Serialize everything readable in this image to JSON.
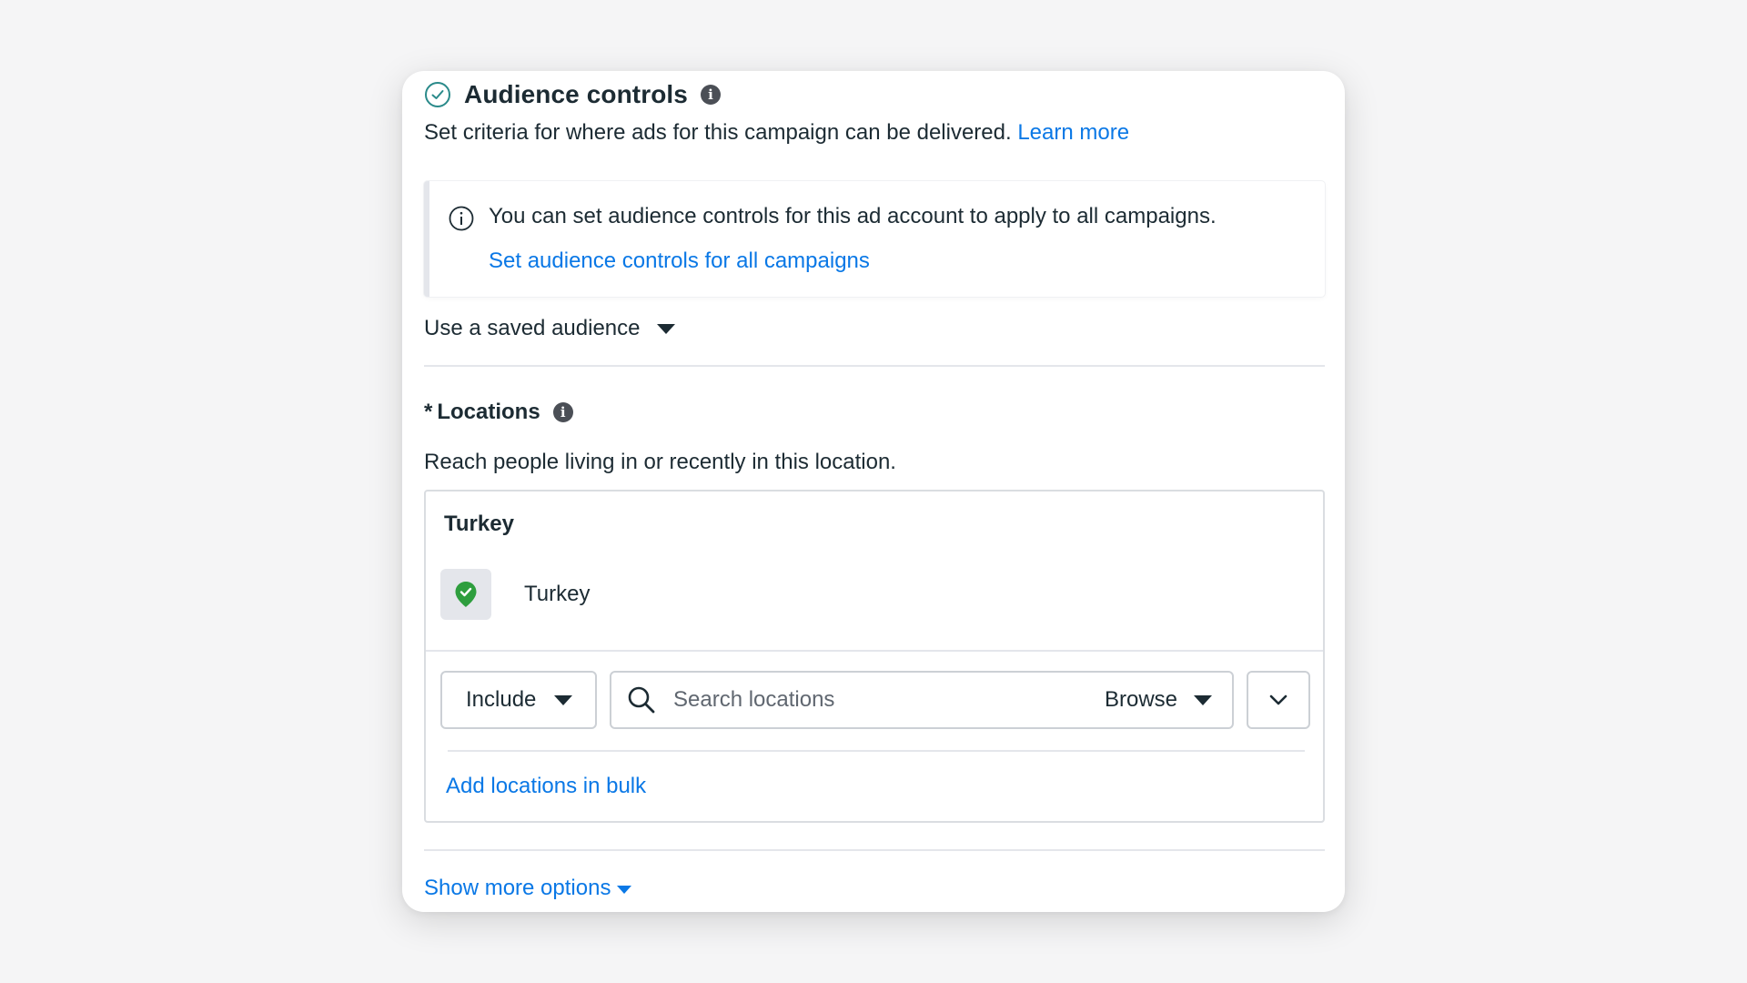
{
  "audience_controls": {
    "title": "Audience controls",
    "subtitle": "Set criteria for where ads for this campaign can be delivered.",
    "learn_more": "Learn more"
  },
  "notice": {
    "text": "You can set audience controls for this ad account to apply to all campaigns.",
    "link": "Set audience controls for all campaigns"
  },
  "saved_audience": {
    "label": "Use a saved audience"
  },
  "locations": {
    "required_mark": "*",
    "title": "Locations",
    "description": "Reach people living in or recently in this location.",
    "group_title": "Turkey",
    "items": [
      {
        "label": "Turkey"
      }
    ],
    "include_label": "Include",
    "search_placeholder": "Search locations",
    "browse_label": "Browse",
    "bulk_link": "Add locations in bulk"
  },
  "show_more": "Show more options",
  "colors": {
    "link": "#0a78e6",
    "success_green": "#2e9e3e",
    "teal_check": "#2a8a8a",
    "text": "#1c2b33"
  },
  "icons": [
    "check-circle-icon",
    "info-icon",
    "info-outline-icon",
    "caret-down-icon",
    "location-pin-icon",
    "search-icon",
    "chevron-down-icon"
  ]
}
